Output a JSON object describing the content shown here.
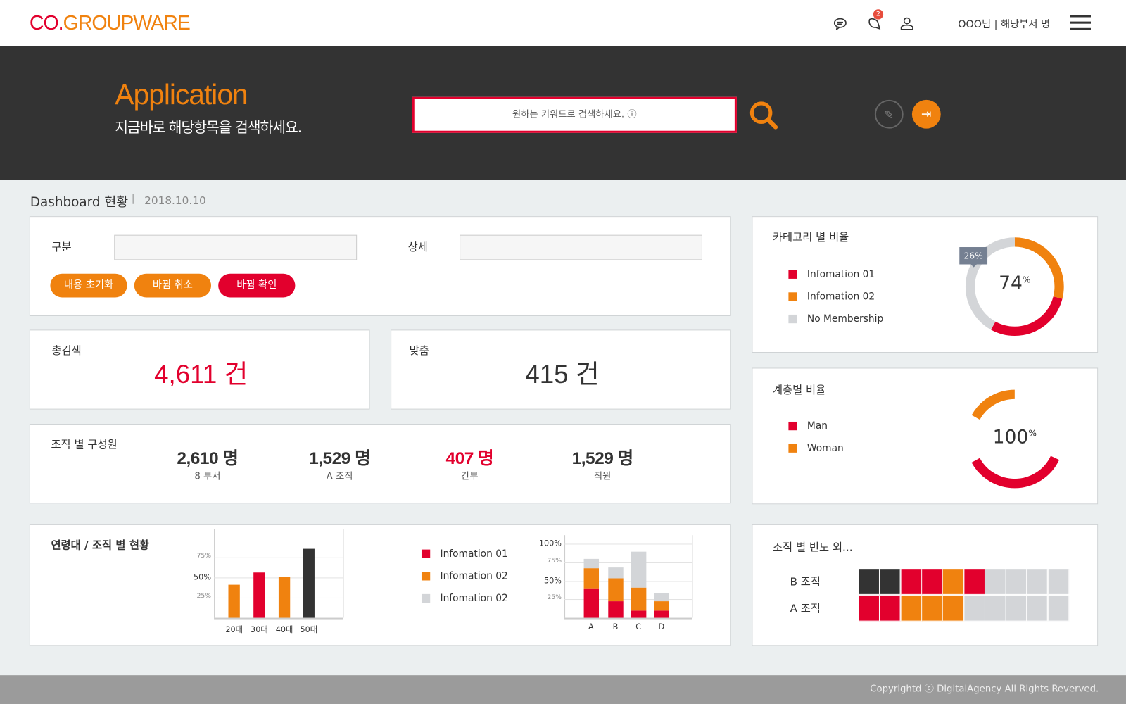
{
  "colors": {
    "orange": "#f0820f",
    "red": "#e2002d",
    "dark": "#333333",
    "gray": "#d3d5d8"
  },
  "header": {
    "logo_prefix": "CO.",
    "logo_main": "GROUPWARE",
    "icons": [
      "chat-icon",
      "notification-icon",
      "user-icon",
      "menu-icon"
    ],
    "notification_count": "2",
    "user_text": "OOO님 | 해당부서 명"
  },
  "hero": {
    "title": "Application",
    "subtitle": "지금바로 해당항목을 검색하세요.",
    "search_placeholder": "원하는 키워드로 검색하세요. ⓘ"
  },
  "dashboard": {
    "title": "Dashboard 현황",
    "separator": "|",
    "date": "2018.10.10"
  },
  "filter": {
    "category_label": "구분",
    "category_value": "",
    "detail_label": "상세",
    "detail_value": "",
    "buttons": [
      "내용 초기화",
      "바뀜 취소",
      "바뀜 확인"
    ]
  },
  "totals": {
    "total_label": "총검색",
    "total_value": "4,611 건",
    "match_label": "맞춤",
    "match_value": "415 건"
  },
  "members": {
    "title": "조직 별 구성원",
    "items": [
      {
        "value": "2,610 명",
        "label": "8 부서"
      },
      {
        "value": "1,529 명",
        "label": "A 조직"
      },
      {
        "value": "407 명",
        "label": "간부",
        "highlight": true
      },
      {
        "value": "1,529 명",
        "label": "직원"
      }
    ]
  },
  "category_ratio": {
    "title": "카테고리 별 비율",
    "legend": [
      "Infomation 01",
      "Infomation 02",
      "No Membership"
    ],
    "center": "74",
    "center_unit": "%",
    "tooltip": "26%",
    "segments": [
      {
        "name": "Infomation 02",
        "fraction": 0.29,
        "color": "#f0820f"
      },
      {
        "name": "Infomation 01",
        "fraction": 0.29,
        "color": "#e2002d"
      },
      {
        "name": "No Membership",
        "fraction": 0.42,
        "color": "#d3d5d8"
      }
    ]
  },
  "level_ratio": {
    "title": "계층별 비율",
    "legend": [
      "Man",
      "Woman"
    ],
    "center": "100",
    "center_unit": "%",
    "segments": [
      {
        "name": "Woman",
        "fraction": 0.65,
        "color": "#f0820f",
        "start": 0.83
      },
      {
        "name": "Man",
        "fraction": 0.35,
        "color": "#e2002d",
        "start": 0.32
      }
    ]
  },
  "age_org": {
    "title": "연령대 / 조직 별 현황",
    "legend": [
      "Infomation 01",
      "Infomation 02",
      "Infomation 02"
    ]
  },
  "chart_data": [
    {
      "type": "bar",
      "categories": [
        "20대",
        "30대",
        "40대",
        "50대"
      ],
      "values": [
        41,
        56,
        51,
        86
      ],
      "colors": [
        "#f0820f",
        "#e2002d",
        "#f0820f",
        "#333333"
      ],
      "yticks": [
        "75%",
        "50%",
        "25%"
      ],
      "ytick_values": [
        75,
        50,
        25
      ],
      "ylim": [
        0,
        100
      ],
      "grid": true
    },
    {
      "type": "bar",
      "stacked": true,
      "categories": [
        "A",
        "B",
        "C",
        "D"
      ],
      "series": [
        {
          "name": "Infomation 01",
          "color": "#e2002d",
          "values": [
            40,
            22,
            10,
            10
          ]
        },
        {
          "name": "Infomation 02",
          "color": "#f0820f",
          "values": [
            27,
            31,
            31,
            12
          ]
        },
        {
          "name": "Infomation 02",
          "color": "#d3d5d8",
          "values": [
            13,
            15,
            48,
            11
          ]
        }
      ],
      "yticks": [
        "100%",
        "75%",
        "50%",
        "25%"
      ],
      "ytick_values": [
        100,
        75,
        50,
        25
      ],
      "ylim": [
        0,
        100
      ],
      "grid": true
    }
  ],
  "frequency": {
    "title": "조직 별 빈도 외...",
    "rows": [
      {
        "label": "B 조직",
        "cells": [
          "dark",
          "dark",
          "red",
          "red",
          "orange",
          "red",
          "gray",
          "gray",
          "gray",
          "gray"
        ]
      },
      {
        "label": "A 조직",
        "cells": [
          "red",
          "red",
          "orange",
          "orange",
          "orange",
          "gray",
          "gray",
          "gray",
          "gray",
          "gray"
        ]
      }
    ]
  },
  "footer": {
    "text": "Copyrightd ⓒ DigitalAgency All Rights Reverved."
  }
}
